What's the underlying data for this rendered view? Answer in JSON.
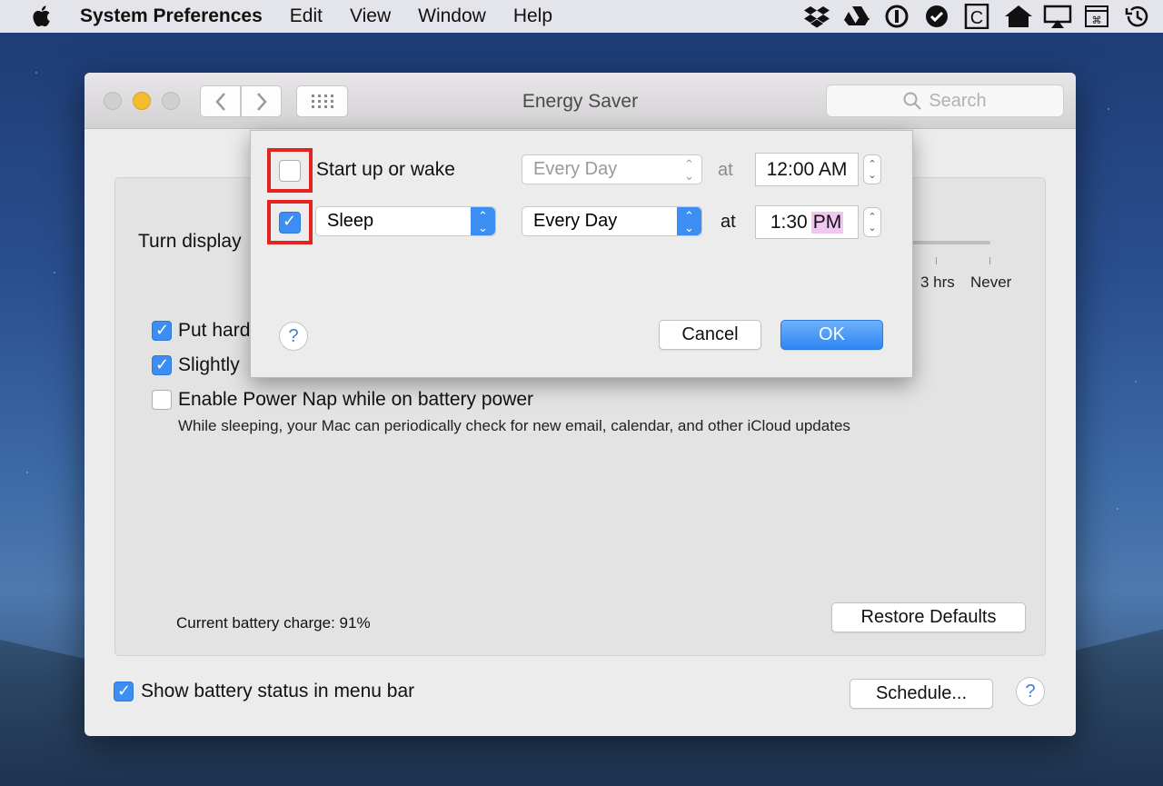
{
  "menubar": {
    "app_name": "System Preferences",
    "items": [
      "Edit",
      "View",
      "Window",
      "Help"
    ],
    "status_icons": [
      "dropbox-icon",
      "google-drive-icon",
      "1password-icon",
      "checkmark-circle-icon",
      "c-box-icon",
      "home-icon",
      "airplay-icon",
      "keyboard-viewer-icon",
      "time-machine-icon"
    ]
  },
  "window": {
    "title": "Energy Saver",
    "search_placeholder": "Search"
  },
  "panel": {
    "turn_display_label": "Turn display",
    "slider_labels": [
      "3 hrs",
      "Never"
    ],
    "options": [
      {
        "label": "Put hard",
        "checked": true
      },
      {
        "label": "Slightly",
        "checked": true
      },
      {
        "label": "Enable Power Nap while on battery power",
        "checked": false
      }
    ],
    "power_nap_description": "While sleeping, your Mac can periodically check for new email, calendar, and other iCloud updates",
    "battery_charge": "Current battery charge: 91%",
    "restore_defaults": "Restore Defaults",
    "show_battery_status": "Show battery status in menu bar",
    "show_battery_checked": true,
    "schedule_button": "Schedule...",
    "help": "?"
  },
  "schedule_sheet": {
    "row1": {
      "checked": false,
      "label": "Start up or wake",
      "day": "Every Day",
      "at": "at",
      "time": "12:00 AM"
    },
    "row2": {
      "checked": true,
      "action": "Sleep",
      "day": "Every Day",
      "at": "at",
      "time": "1:30",
      "ampm": "PM"
    },
    "help": "?",
    "cancel": "Cancel",
    "ok": "OK"
  },
  "colors": {
    "accent": "#3d8ef3",
    "highlight_box": "#e3231f",
    "ampm_selection": "#f1c6f1"
  }
}
